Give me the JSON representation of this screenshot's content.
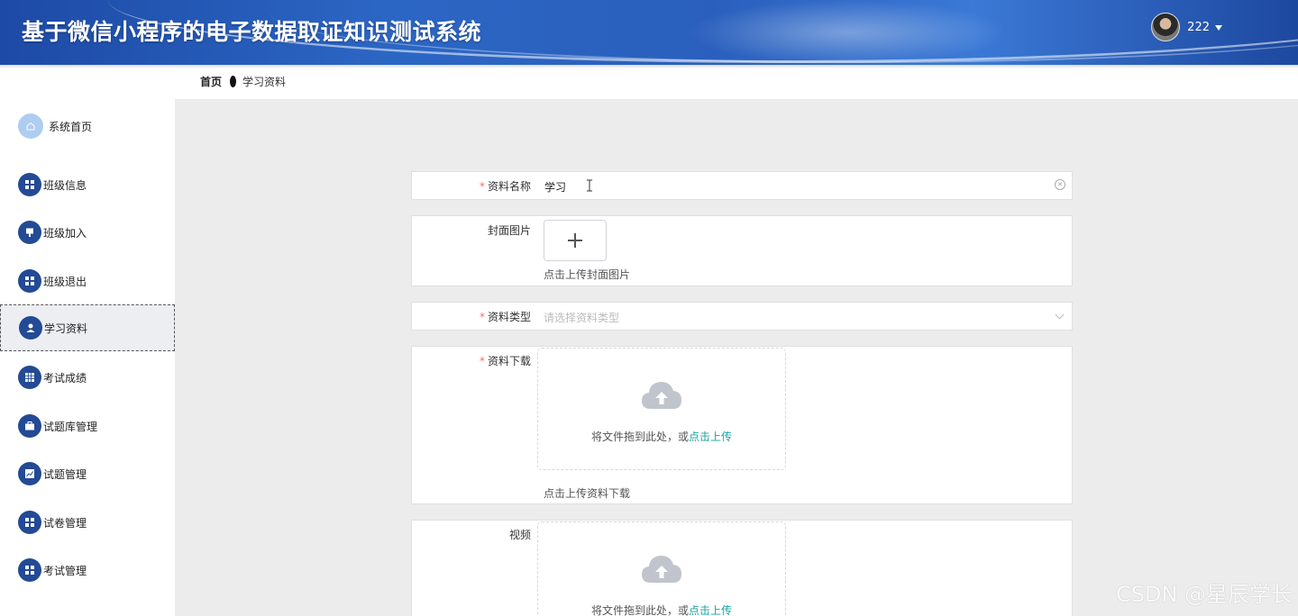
{
  "header": {
    "title": "基于微信小程序的电子数据取证知识测试系统",
    "username": "222"
  },
  "breadcrumb": {
    "home": "首页",
    "current": "学习资料"
  },
  "sidebar": {
    "items": [
      {
        "label": "系统首页",
        "icon": "home-icon"
      },
      {
        "label": "班级信息",
        "icon": "grid-icon"
      },
      {
        "label": "班级加入",
        "icon": "tag-icon"
      },
      {
        "label": "班级退出",
        "icon": "grid-icon"
      },
      {
        "label": "学习资料",
        "icon": "user-icon",
        "active": true
      },
      {
        "label": "考试成绩",
        "icon": "table-icon"
      },
      {
        "label": "试题库管理",
        "icon": "briefcase-icon"
      },
      {
        "label": "试题管理",
        "icon": "chart-icon"
      },
      {
        "label": "试卷管理",
        "icon": "grid-icon"
      },
      {
        "label": "考试管理",
        "icon": "grid-icon"
      }
    ]
  },
  "form": {
    "name": {
      "label": "资料名称",
      "required": true,
      "value": "学习"
    },
    "cover": {
      "label": "封面图片",
      "tip": "点击上传封面图片"
    },
    "type": {
      "label": "资料类型",
      "required": true,
      "placeholder": "请选择资料类型"
    },
    "file": {
      "label": "资料下载",
      "required": true,
      "drop_text": "将文件拖到此处，或",
      "drop_link": "点击上传",
      "tip": "点击上传资料下载"
    },
    "video": {
      "label": "视频",
      "drop_text": "将文件拖到此处，或",
      "drop_link": "点击上传"
    }
  },
  "watermark": "CSDN @星辰学长"
}
